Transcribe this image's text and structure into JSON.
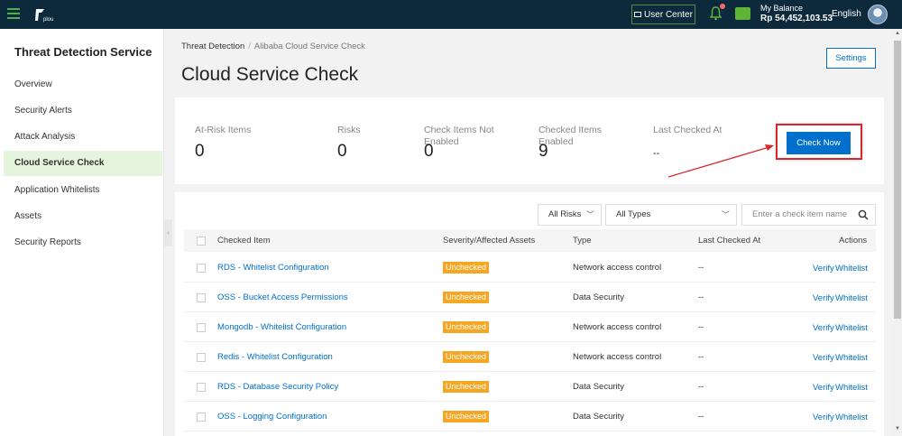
{
  "topbar": {
    "user_center": "User Center",
    "balance_label": "My Balance",
    "balance_value": "Rp 54,452,103.53",
    "language": "English"
  },
  "sidebar": {
    "title": "Threat Detection Service",
    "items": [
      {
        "label": "Overview"
      },
      {
        "label": "Security Alerts"
      },
      {
        "label": "Attack Analysis"
      },
      {
        "label": "Cloud Service Check"
      },
      {
        "label": "Application Whitelists"
      },
      {
        "label": "Assets"
      },
      {
        "label": "Security Reports"
      }
    ],
    "active_index": 3
  },
  "header": {
    "breadcrumb_root": "Threat Detection",
    "breadcrumb_sep": "/",
    "breadcrumb_current": "Alibaba Cloud Service Check",
    "title": "Cloud Service Check",
    "settings_label": "Settings"
  },
  "stats": [
    {
      "label": "At-Risk Items",
      "value": "0"
    },
    {
      "label": "Risks",
      "value": "0"
    },
    {
      "label": "Check Items Not Enabled",
      "value": "0"
    },
    {
      "label": "Checked Items Enabled",
      "value": "9"
    },
    {
      "label": "Last Checked At",
      "value": "--"
    }
  ],
  "check_now_label": "Check Now",
  "filters": {
    "risk_selected": "All Risks",
    "type_selected": "All Types",
    "search_placeholder": "Enter a check item name"
  },
  "table": {
    "columns": [
      "Checked Item",
      "Severity/Affected Assets",
      "Type",
      "Last Checked At",
      "Actions"
    ],
    "rows": [
      {
        "item": "RDS - Whitelist Configuration",
        "severity": "Unchecked",
        "type": "Network access control",
        "last": "--",
        "verify": "Verify",
        "whitelist": "Whitelist"
      },
      {
        "item": "OSS - Bucket Access Permissions",
        "severity": "Unchecked",
        "type": "Data Security",
        "last": "--",
        "verify": "Verify",
        "whitelist": "Whitelist"
      },
      {
        "item": "Mongodb - Whitelist Configuration",
        "severity": "Unchecked",
        "type": "Network access control",
        "last": "--",
        "verify": "Verify",
        "whitelist": "Whitelist"
      },
      {
        "item": "Redis - Whitelist Configuration",
        "severity": "Unchecked",
        "type": "Network access control",
        "last": "--",
        "verify": "Verify",
        "whitelist": "Whitelist"
      },
      {
        "item": "RDS - Database Security Policy",
        "severity": "Unchecked",
        "type": "Data Security",
        "last": "--",
        "verify": "Verify",
        "whitelist": "Whitelist"
      },
      {
        "item": "OSS - Logging Configuration",
        "severity": "Unchecked",
        "type": "Data Security",
        "last": "--",
        "verify": "Verify",
        "whitelist": "Whitelist"
      }
    ]
  },
  "colors": {
    "topbar": "#0d2a3d",
    "primary": "#0070cc",
    "active_nav": "#e5f4dc",
    "badge": "#f5a623",
    "annotation": "#d9262c"
  }
}
